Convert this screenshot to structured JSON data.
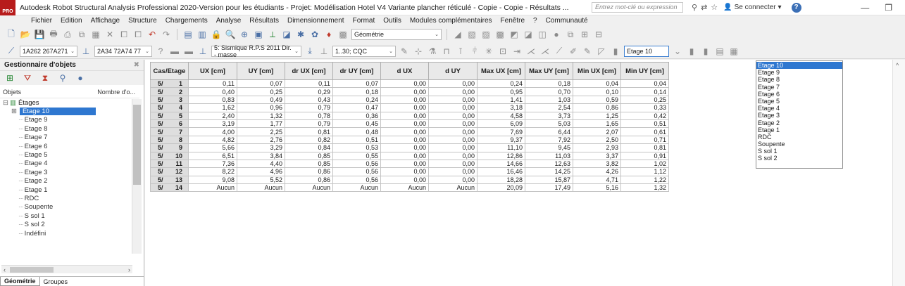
{
  "window": {
    "logo_text": "PRO",
    "title": "Autodesk Robot Structural Analysis Professional 2020-Version pour les étudiants - Projet: Modélisation Hotel V4 Variante plancher réticulé - Copie - Copie - Résultats ...",
    "search_placeholder": "Entrez mot-clé ou expression",
    "sign_in": "Se connecter",
    "help": "?",
    "minimize": "—",
    "restore": "❐"
  },
  "menu": [
    "Fichier",
    "Edition",
    "Affichage",
    "Structure",
    "Chargements",
    "Analyse",
    "Résultats",
    "Dimensionnement",
    "Format",
    "Outils",
    "Modules complémentaires",
    "Fenêtre",
    "?",
    "Communauté"
  ],
  "toolbar1": {
    "view_combo": "Géométrie"
  },
  "toolbar2": {
    "bars_combo": "1A262 267A271",
    "nodes_combo": "2A34 72A74 77",
    "case_combo": "5: Sismique R.P.S 2011 Dir. - masse",
    "mode_combo": "1..30; CQC",
    "level_combo": "Etage 10"
  },
  "left_panel": {
    "title": "Gestionnaire d'objets",
    "col_objects": "Objets",
    "col_count": "Nombre d'o...",
    "root": "Étages",
    "items": [
      "Etage 10",
      "Etage 9",
      "Etage 8",
      "Etage 7",
      "Etage 6",
      "Etage 5",
      "Etage 4",
      "Etage 3",
      "Etage 2",
      "Etage 1",
      "RDC",
      "Soupente",
      "S sol 1",
      "S sol 2",
      "Indéfini"
    ],
    "tabs": [
      "Géométrie",
      "Groupes"
    ]
  },
  "table": {
    "headers": [
      "Cas/Etage",
      "UX [cm]",
      "UY [cm]",
      "dr UX [cm]",
      "dr UY [cm]",
      "d UX",
      "d UY",
      "Max UX [cm]",
      "Max UY [cm]",
      "Min UX [cm]",
      "Min UY [cm]"
    ],
    "rows": [
      {
        "cas": "5/",
        "etage": "1",
        "v": [
          "0,11",
          "0,07",
          "0,11",
          "0,07",
          "0,00",
          "0,00",
          "0,24",
          "0,18",
          "0,04",
          "0,04"
        ]
      },
      {
        "cas": "5/",
        "etage": "2",
        "v": [
          "0,40",
          "0,25",
          "0,29",
          "0,18",
          "0,00",
          "0,00",
          "0,95",
          "0,70",
          "0,10",
          "0,14"
        ]
      },
      {
        "cas": "5/",
        "etage": "3",
        "v": [
          "0,83",
          "0,49",
          "0,43",
          "0,24",
          "0,00",
          "0,00",
          "1,41",
          "1,03",
          "0,59",
          "0,25"
        ]
      },
      {
        "cas": "5/",
        "etage": "4",
        "v": [
          "1,62",
          "0,96",
          "0,79",
          "0,47",
          "0,00",
          "0,00",
          "3,18",
          "2,54",
          "0,86",
          "0,33"
        ]
      },
      {
        "cas": "5/",
        "etage": "5",
        "v": [
          "2,40",
          "1,32",
          "0,78",
          "0,36",
          "0,00",
          "0,00",
          "4,58",
          "3,73",
          "1,25",
          "0,42"
        ]
      },
      {
        "cas": "5/",
        "etage": "6",
        "v": [
          "3,19",
          "1,77",
          "0,79",
          "0,45",
          "0,00",
          "0,00",
          "6,09",
          "5,03",
          "1,65",
          "0,51"
        ]
      },
      {
        "cas": "5/",
        "etage": "7",
        "v": [
          "4,00",
          "2,25",
          "0,81",
          "0,48",
          "0,00",
          "0,00",
          "7,69",
          "6,44",
          "2,07",
          "0,61"
        ]
      },
      {
        "cas": "5/",
        "etage": "8",
        "v": [
          "4,82",
          "2,76",
          "0,82",
          "0,51",
          "0,00",
          "0,00",
          "9,37",
          "7,92",
          "2,50",
          "0,71"
        ]
      },
      {
        "cas": "5/",
        "etage": "9",
        "v": [
          "5,66",
          "3,29",
          "0,84",
          "0,53",
          "0,00",
          "0,00",
          "11,10",
          "9,45",
          "2,93",
          "0,81"
        ]
      },
      {
        "cas": "5/",
        "etage": "10",
        "v": [
          "6,51",
          "3,84",
          "0,85",
          "0,55",
          "0,00",
          "0,00",
          "12,86",
          "11,03",
          "3,37",
          "0,91"
        ]
      },
      {
        "cas": "5/",
        "etage": "11",
        "v": [
          "7,36",
          "4,40",
          "0,85",
          "0,56",
          "0,00",
          "0,00",
          "14,66",
          "12,63",
          "3,82",
          "1,02"
        ]
      },
      {
        "cas": "5/",
        "etage": "12",
        "v": [
          "8,22",
          "4,96",
          "0,86",
          "0,56",
          "0,00",
          "0,00",
          "16,46",
          "14,25",
          "4,26",
          "1,12"
        ]
      },
      {
        "cas": "5/",
        "etage": "13",
        "v": [
          "9,08",
          "5,52",
          "0,86",
          "0,56",
          "0,00",
          "0,00",
          "18,28",
          "15,87",
          "4,71",
          "1,22"
        ]
      },
      {
        "cas": "5/",
        "etage": "14",
        "v": [
          "Aucun",
          "Aucun",
          "Aucun",
          "Aucun",
          "Aucun",
          "Aucun",
          "20,09",
          "17,49",
          "5,16",
          "1,32"
        ]
      }
    ]
  },
  "level_dropdown": {
    "options": [
      "Etage 10",
      "Etage 9",
      "Etage 8",
      "Etage 7",
      "Etage 6",
      "Etage 5",
      "Etage 4",
      "Etage 3",
      "Etage 2",
      "Etage 1",
      "RDC",
      "Soupente",
      "S sol 1",
      "S sol 2"
    ],
    "selected": "Etage 10"
  }
}
